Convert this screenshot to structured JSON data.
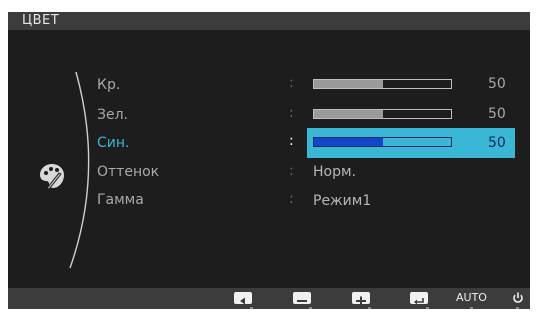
{
  "title": "ЦВЕТ",
  "menu": {
    "items": [
      {
        "label": "Кр.",
        "type": "slider",
        "value": 50,
        "max": 100,
        "active": false
      },
      {
        "label": "Зел.",
        "type": "slider",
        "value": 50,
        "max": 100,
        "active": false
      },
      {
        "label": "Син.",
        "type": "slider",
        "value": 50,
        "max": 100,
        "active": true
      },
      {
        "label": "Оттенок",
        "type": "text",
        "value": "Норм.",
        "active": false
      },
      {
        "label": "Гамма",
        "type": "text",
        "value": "Режим1",
        "active": false
      }
    ],
    "separator": ":"
  },
  "bottom_bar": {
    "buttons": [
      {
        "name": "left-arrow-button",
        "icon": "left-arrow-icon"
      },
      {
        "name": "minus-button",
        "icon": "minus-icon"
      },
      {
        "name": "plus-button",
        "icon": "plus-icon"
      },
      {
        "name": "enter-button",
        "icon": "enter-icon"
      },
      {
        "name": "auto-button",
        "label": "AUTO"
      },
      {
        "name": "power-button",
        "icon": "power-icon"
      }
    ]
  },
  "colors": {
    "highlight": "#3ab6d6",
    "slider_active_fill": "#1546c8",
    "background": "#1d1d1d"
  }
}
